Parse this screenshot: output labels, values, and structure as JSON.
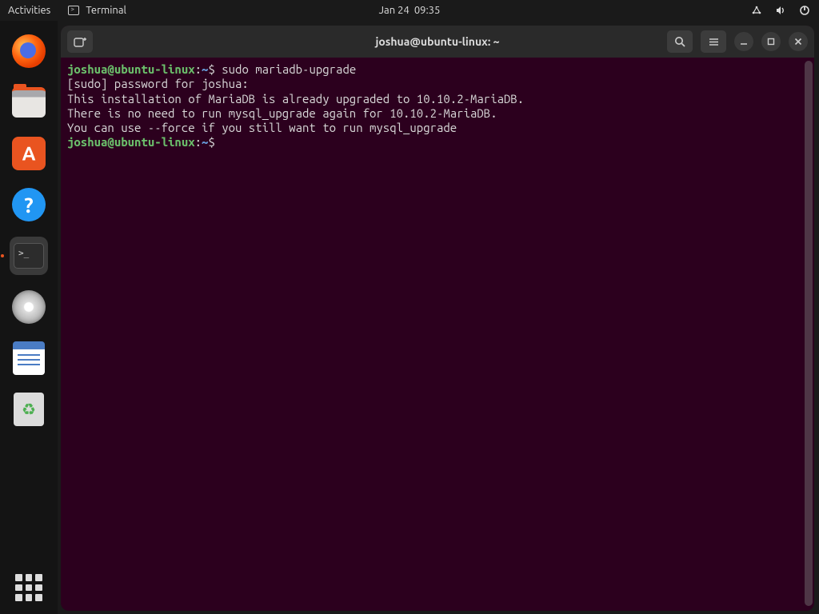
{
  "topbar": {
    "activities": "Activities",
    "app_name": "Terminal",
    "date": "Jan 24",
    "time": "09:35"
  },
  "dock": {
    "items": [
      {
        "name": "firefox"
      },
      {
        "name": "files"
      },
      {
        "name": "software"
      },
      {
        "name": "help",
        "glyph": "?"
      },
      {
        "name": "terminal",
        "active": true
      },
      {
        "name": "disk"
      },
      {
        "name": "text-editor"
      },
      {
        "name": "trash",
        "glyph": "♻"
      }
    ]
  },
  "window": {
    "title": "joshua@ubuntu-linux: ~"
  },
  "terminal": {
    "prompt": {
      "user": "joshua",
      "at": "@",
      "host": "ubuntu-linux",
      "path": "~",
      "symbol": "$"
    },
    "command1": "sudo mariadb-upgrade",
    "line_sudo": "[sudo] password for joshua:",
    "line1": "This installation of MariaDB is already upgraded to 10.10.2-MariaDB.",
    "line2": "There is no need to run mysql_upgrade again for 10.10.2-MariaDB.",
    "line3": "You can use --force if you still want to run mysql_upgrade"
  }
}
